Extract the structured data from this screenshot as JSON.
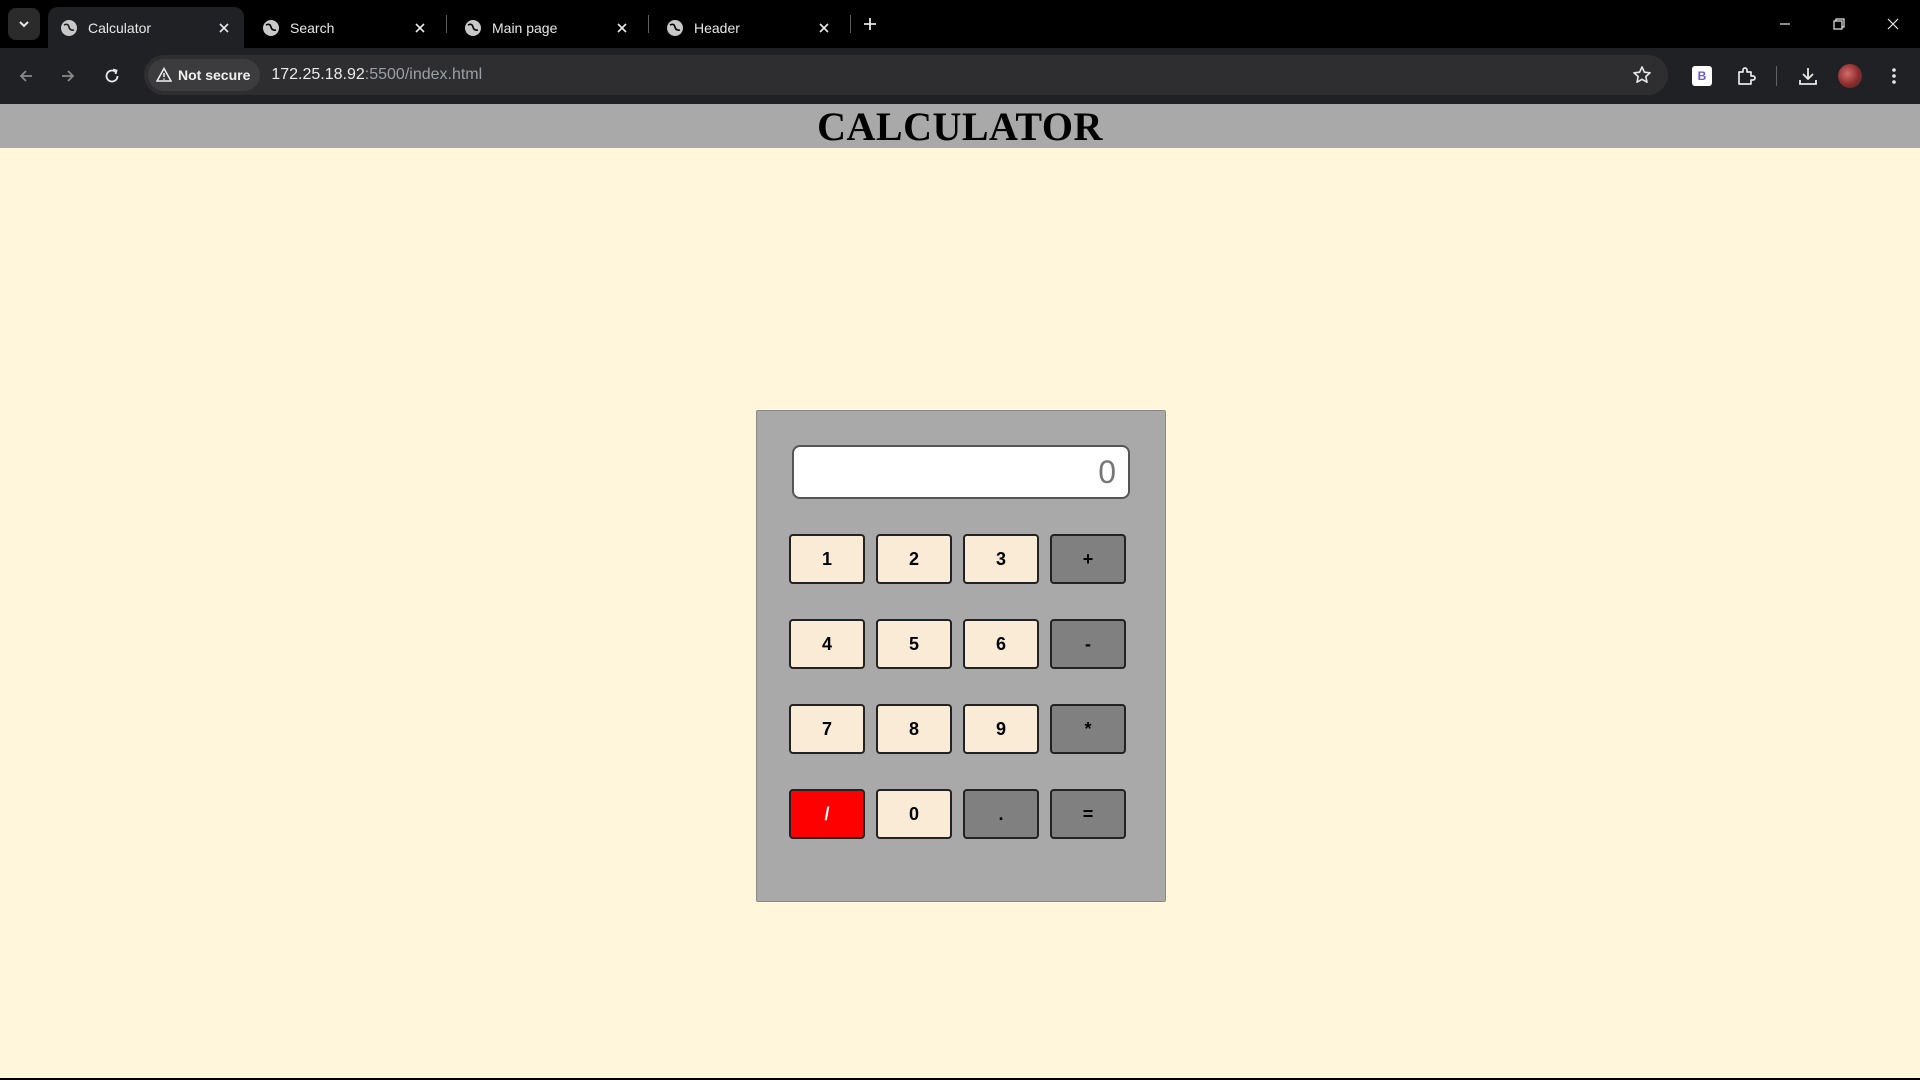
{
  "browser": {
    "tabs": [
      {
        "title": "Calculator",
        "active": true
      },
      {
        "title": "Search",
        "active": false
      },
      {
        "title": "Main page",
        "active": false
      },
      {
        "title": "Header",
        "active": false
      }
    ],
    "security_label": "Not secure",
    "url_host": "172.25.18.92",
    "url_rest": ":5500/index.html",
    "extension_badge": "B"
  },
  "page": {
    "title": "CALCULATOR"
  },
  "calculator": {
    "display_placeholder": "0",
    "keys": {
      "k1": "1",
      "k2": "2",
      "k3": "3",
      "add": "+",
      "k4": "4",
      "k5": "5",
      "k6": "6",
      "subtract": "-",
      "k7": "7",
      "k8": "8",
      "k9": "9",
      "multiply": "*",
      "divide": "/",
      "k0": "0",
      "dot": ".",
      "equals": "="
    },
    "colors": {
      "digit": "#faebd7",
      "operator": "#808080",
      "divide": "#ff0000",
      "body": "#a9a9a9",
      "page_background": "#fff6dc"
    }
  }
}
